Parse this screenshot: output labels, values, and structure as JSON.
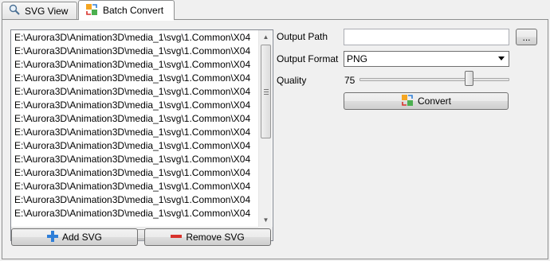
{
  "tabs": [
    {
      "label": "SVG View",
      "icon": "magnifier-icon"
    },
    {
      "label": "Batch Convert",
      "icon": "convert-icon"
    }
  ],
  "files": [
    "E:\\Aurora3D\\Animation3D\\media_1\\svg\\1.Common\\X04",
    "E:\\Aurora3D\\Animation3D\\media_1\\svg\\1.Common\\X04",
    "E:\\Aurora3D\\Animation3D\\media_1\\svg\\1.Common\\X04",
    "E:\\Aurora3D\\Animation3D\\media_1\\svg\\1.Common\\X04",
    "E:\\Aurora3D\\Animation3D\\media_1\\svg\\1.Common\\X04",
    "E:\\Aurora3D\\Animation3D\\media_1\\svg\\1.Common\\X04",
    "E:\\Aurora3D\\Animation3D\\media_1\\svg\\1.Common\\X04",
    "E:\\Aurora3D\\Animation3D\\media_1\\svg\\1.Common\\X04",
    "E:\\Aurora3D\\Animation3D\\media_1\\svg\\1.Common\\X04",
    "E:\\Aurora3D\\Animation3D\\media_1\\svg\\1.Common\\X04",
    "E:\\Aurora3D\\Animation3D\\media_1\\svg\\1.Common\\X04",
    "E:\\Aurora3D\\Animation3D\\media_1\\svg\\1.Common\\X04",
    "E:\\Aurora3D\\Animation3D\\media_1\\svg\\1.Common\\X04",
    "E:\\Aurora3D\\Animation3D\\media_1\\svg\\1.Common\\X04"
  ],
  "buttons": {
    "add_svg": "Add SVG",
    "remove_svg": "Remove SVG",
    "browse": "...",
    "convert": "Convert"
  },
  "settings": {
    "output_path_label": "Output Path",
    "output_path_value": "",
    "output_format_label": "Output Format",
    "output_format_value": "PNG",
    "quality_label": "Quality",
    "quality_value": "75",
    "quality_slider_fraction": 0.75
  },
  "colors": {
    "add_icon": "#2f7fd8",
    "remove_icon": "#d8322c"
  }
}
